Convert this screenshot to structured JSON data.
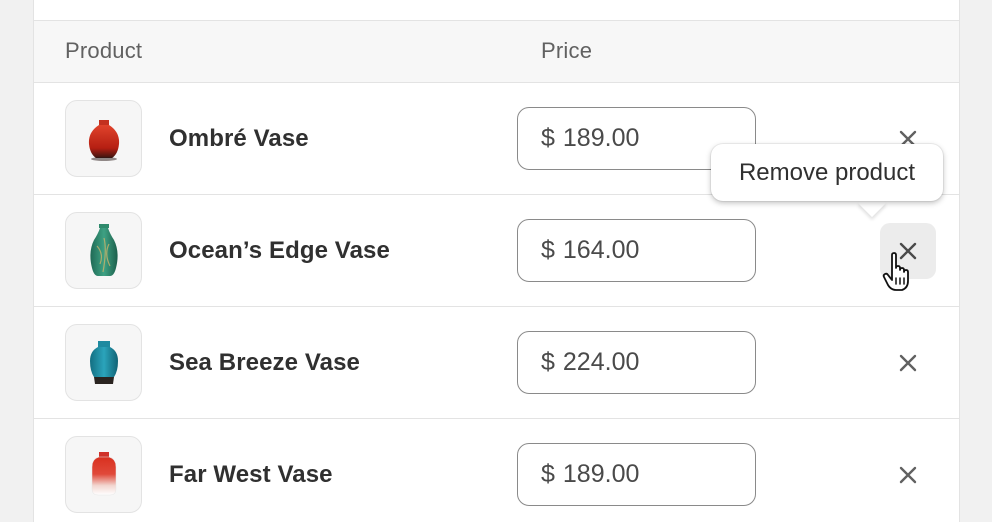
{
  "table": {
    "headers": {
      "product": "Product",
      "price": "Price"
    },
    "rows": [
      {
        "name": "Ombré Vase",
        "currency": "$",
        "price": "189.00",
        "thumb": "red-vase-image",
        "vase_color": "#c8301f"
      },
      {
        "name": "Ocean’s Edge Vase",
        "currency": "$",
        "price": "164.00",
        "thumb": "green-vase-image",
        "vase_color": "#2f8a6c"
      },
      {
        "name": "Sea Breeze Vase",
        "currency": "$",
        "price": "224.00",
        "thumb": "teal-vase-image",
        "vase_color": "#1e8aa0"
      },
      {
        "name": "Far West Vase",
        "currency": "$",
        "price": "189.00",
        "thumb": "red-white-vase-image",
        "vase_color": "#d0322a"
      }
    ]
  },
  "tooltip": {
    "text": "Remove product",
    "target_row": 1
  },
  "icons": {
    "remove": "close-icon",
    "cursor": "hand-pointer-icon"
  }
}
